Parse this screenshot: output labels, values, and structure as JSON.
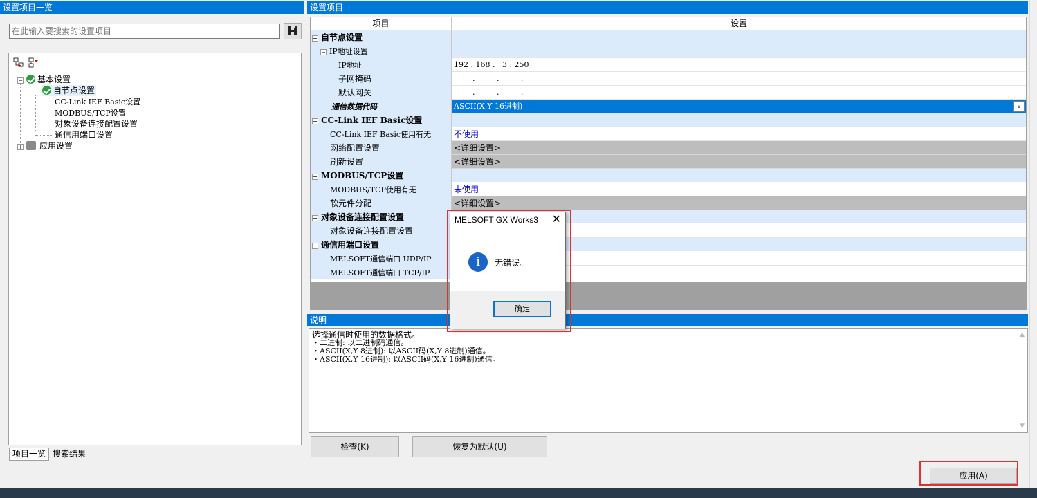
{
  "left_panel": {
    "title": "设置项目一览",
    "search_placeholder": "在此输入要搜索的设置项目",
    "tree": [
      {
        "label": "基本设置"
      },
      {
        "label": "自节点设置"
      },
      {
        "label": "CC-Link IEF Basic设置"
      },
      {
        "label": "MODBUS/TCP设置"
      },
      {
        "label": "对象设备连接配置设置"
      },
      {
        "label": "通信用端口设置"
      },
      {
        "label": "应用设置"
      }
    ],
    "tabs": [
      "项目一览",
      "搜索结果"
    ]
  },
  "right_panel": {
    "title": "设置项目",
    "col_item": "项目",
    "col_setting": "设置",
    "rows": [
      {
        "label": "自节点设置",
        "value": ""
      },
      {
        "label": "IP地址设置",
        "value": ""
      },
      {
        "label": "IP地址",
        "value": "192 . 168 .   3 . 250"
      },
      {
        "label": "子网掩码",
        "value": ".         .         ."
      },
      {
        "label": "默认网关",
        "value": ".         .         ."
      },
      {
        "label": "通信数据代码",
        "value": "ASCII(X,Y 16进制)"
      },
      {
        "label": "CC-Link IEF Basic设置",
        "value": ""
      },
      {
        "label": "CC-Link IEF Basic使用有无",
        "value": "不使用"
      },
      {
        "label": "网络配置设置",
        "value": "<详细设置>"
      },
      {
        "label": "刷新设置",
        "value": "<详细设置>"
      },
      {
        "label": "MODBUS/TCP设置",
        "value": ""
      },
      {
        "label": "MODBUS/TCP使用有无",
        "value": "未使用"
      },
      {
        "label": "软元件分配",
        "value": "<详细设置>"
      },
      {
        "label": "对象设备连接配置设置",
        "value": ""
      },
      {
        "label": "对象设备连接配置设置",
        "value": ""
      },
      {
        "label": "通信用端口设置",
        "value": ""
      },
      {
        "label": "MELSOFT通信端口  UDP/IP",
        "value": ""
      },
      {
        "label": "MELSOFT通信端口  TCP/IP",
        "value": ""
      }
    ]
  },
  "description": {
    "title": "说明",
    "lines": [
      "选择通信时使用的数据格式。",
      "・二进制: 以二进制码通信。",
      "・ASCII(X,Y 8进制): 以ASCII码(X,Y 8进制)通信。",
      "・ASCII(X,Y 16进制): 以ASCII码(X,Y 16进制)通信。"
    ]
  },
  "buttons": {
    "check": "检查(K)",
    "restore_default": "恢复为默认(U)",
    "apply": "应用(A)"
  },
  "dialog": {
    "title": "MELSOFT GX Works3",
    "message": "无错误。",
    "ok": "确定"
  },
  "colors": {
    "title_bar": "#0078d7",
    "group_row": "#dcebfb",
    "highlight": "#e03030"
  }
}
